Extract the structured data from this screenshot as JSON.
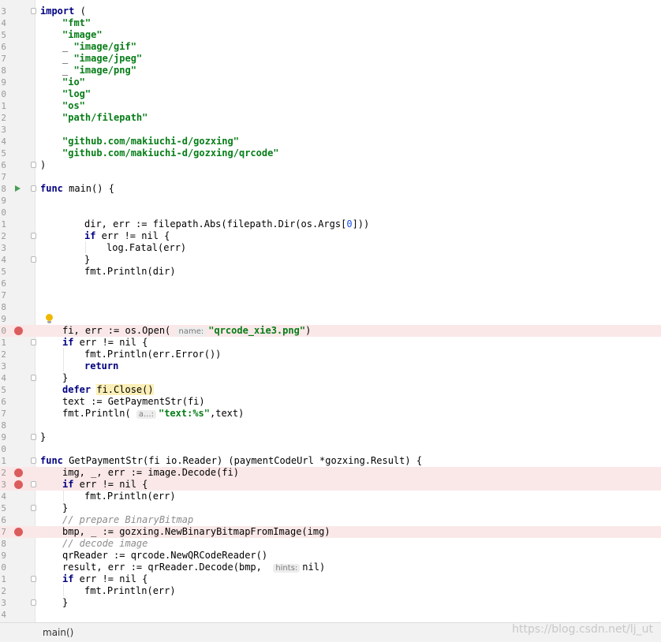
{
  "editor": {
    "lines": [
      {
        "n": "3",
        "text": "import (",
        "kw": true
      },
      {
        "n": "4",
        "text": "\"fmt\""
      },
      {
        "n": "5",
        "text": "\"image\""
      },
      {
        "n": "6",
        "text": "_ \"image/gif\""
      },
      {
        "n": "7",
        "text": "_ \"image/jpeg\""
      },
      {
        "n": "8",
        "text": "_ \"image/png\""
      },
      {
        "n": "9",
        "text": "\"io\""
      },
      {
        "n": "0",
        "text": "\"log\""
      },
      {
        "n": "1",
        "text": "\"os\""
      },
      {
        "n": "2",
        "text": "\"path/filepath\""
      },
      {
        "n": "3",
        "text": ""
      },
      {
        "n": "4",
        "text": "\"github.com/makiuchi-d/gozxing\""
      },
      {
        "n": "5",
        "text": "\"github.com/makiuchi-d/gozxing/qrcode\""
      },
      {
        "n": "6",
        "text": ")"
      },
      {
        "n": "7",
        "text": ""
      },
      {
        "n": "8",
        "text": "func main() {"
      },
      {
        "n": "9",
        "text": ""
      },
      {
        "n": "0",
        "text": ""
      },
      {
        "n": "1",
        "text": "dir, err := filepath.Abs(filepath.Dir(os.Args[0]))"
      },
      {
        "n": "2",
        "text": "if err != nil {"
      },
      {
        "n": "3",
        "text": "log.Fatal(err)"
      },
      {
        "n": "4",
        "text": "}"
      },
      {
        "n": "5",
        "text": "fmt.Println(dir)"
      },
      {
        "n": "6",
        "text": ""
      },
      {
        "n": "7",
        "text": ""
      },
      {
        "n": "8",
        "text": ""
      },
      {
        "n": "9",
        "text": ""
      },
      {
        "n": "0",
        "text": "fi, err := os.Open( name: \"qrcode_xie3.png\")"
      },
      {
        "n": "1",
        "text": "if err != nil {"
      },
      {
        "n": "2",
        "text": "fmt.Println(err.Error())"
      },
      {
        "n": "3",
        "text": "return"
      },
      {
        "n": "4",
        "text": "}"
      },
      {
        "n": "5",
        "text": "defer fi.Close()"
      },
      {
        "n": "6",
        "text": "text := GetPaymentStr(fi)"
      },
      {
        "n": "7",
        "text": "fmt.Println( a...: \"text:%s\",text)"
      },
      {
        "n": "8",
        "text": ""
      },
      {
        "n": "9",
        "text": "}"
      },
      {
        "n": "0",
        "text": ""
      },
      {
        "n": "1",
        "text": "func GetPaymentStr(fi io.Reader) (paymentCodeUrl *gozxing.Result) {"
      },
      {
        "n": "2",
        "text": "img, _, err := image.Decode(fi)"
      },
      {
        "n": "3",
        "text": "if err != nil {"
      },
      {
        "n": "4",
        "text": "fmt.Println(err)"
      },
      {
        "n": "5",
        "text": "}"
      },
      {
        "n": "6",
        "text": "// prepare BinaryBitmap"
      },
      {
        "n": "7",
        "text": "bmp, _ := gozxing.NewBinaryBitmapFromImage(img)"
      },
      {
        "n": "8",
        "text": "// decode image"
      },
      {
        "n": "9",
        "text": "qrReader := qrcode.NewQRCodeReader()"
      },
      {
        "n": "0",
        "text": "result, err := qrReader.Decode(bmp,  hints: nil)"
      },
      {
        "n": "1",
        "text": "if err != nil {"
      },
      {
        "n": "2",
        "text": "fmt.Println(err)"
      },
      {
        "n": "3",
        "text": "}"
      },
      {
        "n": "4",
        "text": ""
      }
    ]
  },
  "statusbar": {
    "breadcrumb": "main()",
    "watermark": "https://blog.csdn.net/lj_ut"
  },
  "colors": {
    "keyword": "#000080",
    "string": "#067d17",
    "breakpoint": "#db5c5c",
    "breakpoint_line": "#fae8e8",
    "run_arrow": "#499c54"
  },
  "icons": [
    "run-arrow-icon",
    "breakpoint-icon",
    "fold-icon",
    "intention-bulb-icon"
  ]
}
